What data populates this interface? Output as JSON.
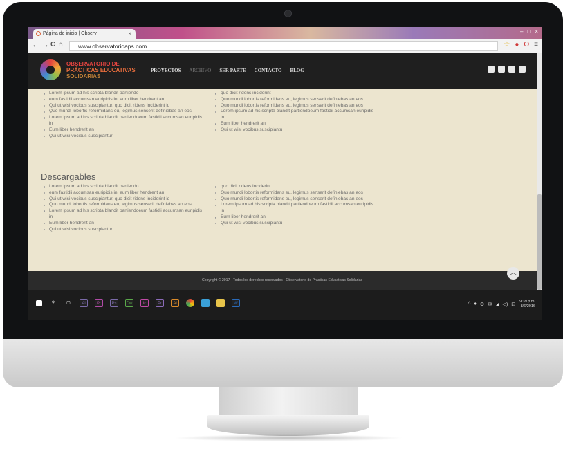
{
  "browser": {
    "tab_title": "Página de inicio | Observ",
    "tab_close": "×",
    "url": "www.observatorioaps.com",
    "back_icon": "←",
    "forward_icon": "→",
    "reload_icon": "C",
    "home_icon": "⌂",
    "window_controls": [
      "–",
      "□",
      "×"
    ]
  },
  "site": {
    "logo": {
      "line1": "OBSERVATORIO DE",
      "line2": "PRÁCTICAS EDUCATIVAS",
      "line3": "SOLIDARIAS"
    },
    "menu": [
      {
        "label": "PROYECTOS",
        "active": true
      },
      {
        "label": "ARCHIVO",
        "active": false
      },
      {
        "label": "SER PARTE",
        "active": true
      },
      {
        "label": "CONTACTO",
        "active": true
      },
      {
        "label": "BLOG",
        "active": true
      }
    ],
    "social_icons": [
      "login-icon",
      "facebook-icon",
      "twitter-icon",
      "youtube-icon"
    ]
  },
  "content": {
    "top_left": [
      "Lorem ipsum ad his scripta blandit partiendo",
      "eum fastidii accumsan euripidis in, eum liber hendrerit an",
      "Qui ut wisi vocibus suscipiantur, quo dicit ridens inciderint id",
      "Quo mundi lobortis reformidans eu, legimus senserit definiebas an eos",
      "Lorem ipsum ad his scripta blandit partiendoeum fastidii accumsan euripidis in",
      "Eum liber hendrerit an",
      "Qui ut wisi vocibus suscipiantur"
    ],
    "top_right": [
      "quo dicit ridens inciderint",
      "Quo mundi lobortis reformidans eu, legimus senserit definiebas an eos",
      "Quo mundi lobortis reformidans eu, legimus senserit definiebas an eos",
      "Lorem ipsum ad his scripta blandit partiendoeum fastidii accumsan euripidis in",
      "Eum liber hendrerit an",
      "Qui ut wisi vocibus suscipiantu"
    ],
    "downloads_title": "Descargables",
    "dl_left": [
      "Lorem ipsum ad his scripta blandit partiendo",
      "eum fastidii accumsan euripidis in, eum liber hendrerit an",
      "Qui ut wisi vocibus suscipiantur, quo dicit ridens inciderint id",
      "Quo mundi lobortis reformidans eu, legimus senserit definiebas an eos",
      "Lorem ipsum ad his scripta blandit partiendoeum fastidii accumsan euripidis in",
      "Eum liber hendrerit an",
      "Qui ut wisi vocibus suscipiantur"
    ],
    "dl_right": [
      "quo dicit ridens inciderint",
      "Quo mundi lobortis reformidans eu, legimus senserit definiebas an eos",
      "Quo mundi lobortis reformidans eu, legimus senserit definiebas an eos",
      "Lorem ipsum ad his scripta blandit partiendoeum fastidii accumsan euripidis in",
      "Eum liber hendrerit an",
      "Qui ut wisi vocibus suscipiantu"
    ]
  },
  "footer": {
    "copyright": "Copyright © 2017 · Todos los derechos reservados · Observatorio de Prácticas Educativas Solidarias",
    "back_to_top": "︿"
  },
  "taskbar": {
    "apps": [
      {
        "name": "windows-start-icon",
        "label": "",
        "color": "#ffffff"
      },
      {
        "name": "search-icon",
        "label": "⚲",
        "color": "#ffffff"
      },
      {
        "name": "task-view-icon",
        "label": "▢",
        "color": "#ffffff"
      },
      {
        "name": "illustrator-ai-icon",
        "label": "Ai",
        "color": "#7a6aa8"
      },
      {
        "name": "premiere-icon",
        "label": "Pr",
        "color": "#b04aa6"
      },
      {
        "name": "photoshop-icon",
        "label": "Ps",
        "color": "#7a6aa8"
      },
      {
        "name": "dreamweaver-icon",
        "label": "Dw",
        "color": "#5aa84a"
      },
      {
        "name": "incopy-icon",
        "label": "Ic",
        "color": "#c04aa6"
      },
      {
        "name": "premiere-2-icon",
        "label": "Pr",
        "color": "#8a6ab8"
      },
      {
        "name": "illustrator-icon",
        "label": "Ai",
        "color": "#d98a2a"
      },
      {
        "name": "chrome-icon",
        "label": "",
        "color": "#e0a020"
      },
      {
        "name": "store-icon",
        "label": "",
        "color": "#3aa0d8"
      },
      {
        "name": "folder-icon",
        "label": "",
        "color": "#e8c44a"
      },
      {
        "name": "word-icon",
        "label": "W",
        "color": "#2a6ab8"
      }
    ],
    "tray_icons": [
      "^",
      "♦",
      "⚙",
      "✉",
      "◢",
      "◁)",
      "⊟"
    ],
    "time": "9:39 p.m.",
    "date": "8/6/2016"
  }
}
